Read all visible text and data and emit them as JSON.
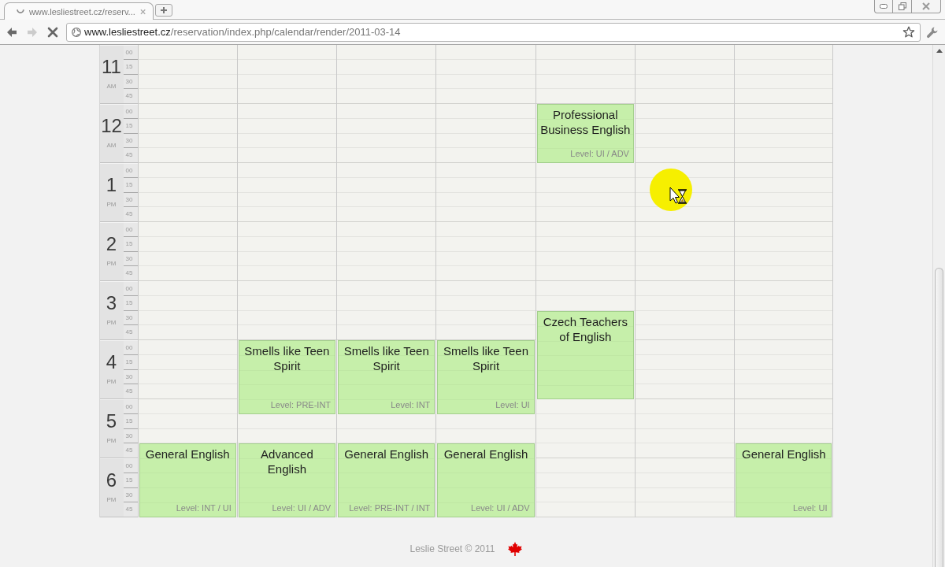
{
  "browser": {
    "tab": {
      "title": "www.lesliestreet.cz/reserv...",
      "loading": true
    },
    "nav": [
      {
        "kind": "back",
        "disabled": false
      },
      {
        "kind": "forward",
        "disabled": true
      },
      {
        "kind": "stop",
        "disabled": false
      }
    ],
    "address": {
      "host": "www.lesliestreet.cz",
      "path": "/reservation/index.php/calendar/render/2011-03-14"
    }
  },
  "calendar": {
    "hours": [
      {
        "hour": "11",
        "period": "AM",
        "minutes": [
          "00",
          "15",
          "30",
          "45"
        ]
      },
      {
        "hour": "12",
        "period": "AM",
        "minutes": [
          "00",
          "15",
          "30",
          "45"
        ]
      },
      {
        "hour": "1",
        "period": "PM",
        "minutes": [
          "00",
          "15",
          "30",
          "45"
        ]
      },
      {
        "hour": "2",
        "period": "PM",
        "minutes": [
          "00",
          "15",
          "30",
          "45"
        ]
      },
      {
        "hour": "3",
        "period": "PM",
        "minutes": [
          "00",
          "15",
          "30",
          "45"
        ]
      },
      {
        "hour": "4",
        "period": "PM",
        "minutes": [
          "00",
          "15",
          "30",
          "45"
        ]
      },
      {
        "hour": "5",
        "period": "PM",
        "minutes": [
          "00",
          "15",
          "30",
          "45"
        ]
      },
      {
        "hour": "6",
        "period": "PM",
        "minutes": [
          "00",
          "15",
          "30",
          "45"
        ]
      }
    ],
    "days": [
      {
        "slots": [
          {
            "booked": false
          },
          {
            "booked": false
          },
          {
            "booked": false
          },
          {
            "booked": false
          },
          {
            "booked": false
          },
          {
            "booked": false
          },
          {
            "booked": false
          },
          {
            "booked": false
          },
          {
            "booked": false
          },
          {
            "booked": false
          },
          {
            "booked": false
          },
          {
            "booked": false
          },
          {
            "booked": false
          },
          {
            "booked": false
          },
          {
            "booked": false
          },
          {
            "booked": false
          },
          {
            "booked": false
          },
          {
            "booked": false
          },
          {
            "booked": false
          },
          {
            "booked": false
          },
          {
            "booked": false
          },
          {
            "booked": false
          },
          {
            "booked": false
          },
          {
            "booked": false
          },
          {
            "booked": false
          },
          {
            "booked": false
          },
          {
            "booked": false
          },
          {
            "booked": true,
            "title": "General English",
            "level": "Level: INT / UI"
          },
          {
            "booked": true
          },
          {
            "booked": true
          },
          {
            "booked": true
          },
          {
            "booked": true
          }
        ]
      },
      {
        "slots": [
          {
            "booked": false
          },
          {
            "booked": false
          },
          {
            "booked": false
          },
          {
            "booked": false
          },
          {
            "booked": false
          },
          {
            "booked": false
          },
          {
            "booked": false
          },
          {
            "booked": false
          },
          {
            "booked": false
          },
          {
            "booked": false
          },
          {
            "booked": false
          },
          {
            "booked": false
          },
          {
            "booked": false
          },
          {
            "booked": false
          },
          {
            "booked": false
          },
          {
            "booked": false
          },
          {
            "booked": false
          },
          {
            "booked": false
          },
          {
            "booked": false
          },
          {
            "booked": false
          },
          {
            "booked": true,
            "title": "Smells like Teen Spirit",
            "level": "Level: PRE-INT"
          },
          {
            "booked": true
          },
          {
            "booked": true
          },
          {
            "booked": true
          },
          {
            "booked": true
          },
          {
            "booked": false
          },
          {
            "booked": false
          },
          {
            "booked": true,
            "title": "Advanced English",
            "level": "Level: UI / ADV"
          },
          {
            "booked": true
          },
          {
            "booked": true
          },
          {
            "booked": true
          },
          {
            "booked": true
          }
        ]
      },
      {
        "slots": [
          {
            "booked": false
          },
          {
            "booked": false
          },
          {
            "booked": false
          },
          {
            "booked": false
          },
          {
            "booked": false
          },
          {
            "booked": false
          },
          {
            "booked": false
          },
          {
            "booked": false
          },
          {
            "booked": false
          },
          {
            "booked": false
          },
          {
            "booked": false
          },
          {
            "booked": false
          },
          {
            "booked": false
          },
          {
            "booked": false
          },
          {
            "booked": false
          },
          {
            "booked": false
          },
          {
            "booked": false
          },
          {
            "booked": false
          },
          {
            "booked": false
          },
          {
            "booked": false
          },
          {
            "booked": true,
            "title": "Smells like Teen Spirit",
            "level": "Level: INT"
          },
          {
            "booked": true
          },
          {
            "booked": true
          },
          {
            "booked": true
          },
          {
            "booked": true
          },
          {
            "booked": false
          },
          {
            "booked": false
          },
          {
            "booked": true,
            "title": "General English",
            "level": "Level: PRE-INT / INT"
          },
          {
            "booked": true
          },
          {
            "booked": true
          },
          {
            "booked": true
          },
          {
            "booked": true
          }
        ]
      },
      {
        "slots": [
          {
            "booked": false
          },
          {
            "booked": false
          },
          {
            "booked": false
          },
          {
            "booked": false
          },
          {
            "booked": false
          },
          {
            "booked": false
          },
          {
            "booked": false
          },
          {
            "booked": false
          },
          {
            "booked": false
          },
          {
            "booked": false
          },
          {
            "booked": false
          },
          {
            "booked": false
          },
          {
            "booked": false
          },
          {
            "booked": false
          },
          {
            "booked": false
          },
          {
            "booked": false
          },
          {
            "booked": false
          },
          {
            "booked": false
          },
          {
            "booked": false
          },
          {
            "booked": false
          },
          {
            "booked": true,
            "title": "Smells like Teen Spirit",
            "level": "Level: UI"
          },
          {
            "booked": true
          },
          {
            "booked": true
          },
          {
            "booked": true
          },
          {
            "booked": true
          },
          {
            "booked": false
          },
          {
            "booked": false
          },
          {
            "booked": true,
            "title": "General English",
            "level": "Level: UI / ADV"
          },
          {
            "booked": true
          },
          {
            "booked": true
          },
          {
            "booked": true
          },
          {
            "booked": true
          }
        ]
      },
      {
        "slots": [
          {
            "booked": false
          },
          {
            "booked": false
          },
          {
            "booked": false
          },
          {
            "booked": false
          },
          {
            "booked": true,
            "title": "Professional Business English",
            "level": "Level: UI / ADV"
          },
          {
            "booked": true
          },
          {
            "booked": true
          },
          {
            "booked": true
          },
          {
            "booked": false
          },
          {
            "booked": false
          },
          {
            "booked": false
          },
          {
            "booked": false
          },
          {
            "booked": false
          },
          {
            "booked": false
          },
          {
            "booked": false
          },
          {
            "booked": false
          },
          {
            "booked": false
          },
          {
            "booked": false
          },
          {
            "booked": true,
            "title": "Czech Teachers of English"
          },
          {
            "booked": true
          },
          {
            "booked": true
          },
          {
            "booked": true
          },
          {
            "booked": true
          },
          {
            "booked": true
          },
          {
            "booked": false
          },
          {
            "booked": false
          },
          {
            "booked": false
          },
          {
            "booked": false
          },
          {
            "booked": false
          },
          {
            "booked": false
          },
          {
            "booked": false
          },
          {
            "booked": false
          }
        ]
      },
      {
        "slots": [
          {
            "booked": false
          },
          {
            "booked": false
          },
          {
            "booked": false
          },
          {
            "booked": false
          },
          {
            "booked": false
          },
          {
            "booked": false
          },
          {
            "booked": false
          },
          {
            "booked": false
          },
          {
            "booked": false
          },
          {
            "booked": false
          },
          {
            "booked": false
          },
          {
            "booked": false
          },
          {
            "booked": false
          },
          {
            "booked": false
          },
          {
            "booked": false
          },
          {
            "booked": false
          },
          {
            "booked": false
          },
          {
            "booked": false
          },
          {
            "booked": false
          },
          {
            "booked": false
          },
          {
            "booked": false
          },
          {
            "booked": false
          },
          {
            "booked": false
          },
          {
            "booked": false
          },
          {
            "booked": false
          },
          {
            "booked": false
          },
          {
            "booked": false
          },
          {
            "booked": false
          },
          {
            "booked": false
          },
          {
            "booked": false
          },
          {
            "booked": false
          },
          {
            "booked": false
          }
        ]
      },
      {
        "slots": [
          {
            "booked": false
          },
          {
            "booked": false
          },
          {
            "booked": false
          },
          {
            "booked": false
          },
          {
            "booked": false
          },
          {
            "booked": false
          },
          {
            "booked": false
          },
          {
            "booked": false
          },
          {
            "booked": false
          },
          {
            "booked": false
          },
          {
            "booked": false
          },
          {
            "booked": false
          },
          {
            "booked": false
          },
          {
            "booked": false
          },
          {
            "booked": false
          },
          {
            "booked": false
          },
          {
            "booked": false
          },
          {
            "booked": false
          },
          {
            "booked": false
          },
          {
            "booked": false
          },
          {
            "booked": false
          },
          {
            "booked": false
          },
          {
            "booked": false
          },
          {
            "booked": false
          },
          {
            "booked": false
          },
          {
            "booked": false
          },
          {
            "booked": false
          },
          {
            "booked": true,
            "title": "General English",
            "level": "Level: UI"
          },
          {
            "booked": true
          },
          {
            "booked": true
          },
          {
            "booked": true
          },
          {
            "booked": true
          }
        ]
      }
    ]
  },
  "footer": {
    "text": "Leslie Street © 2011"
  }
}
